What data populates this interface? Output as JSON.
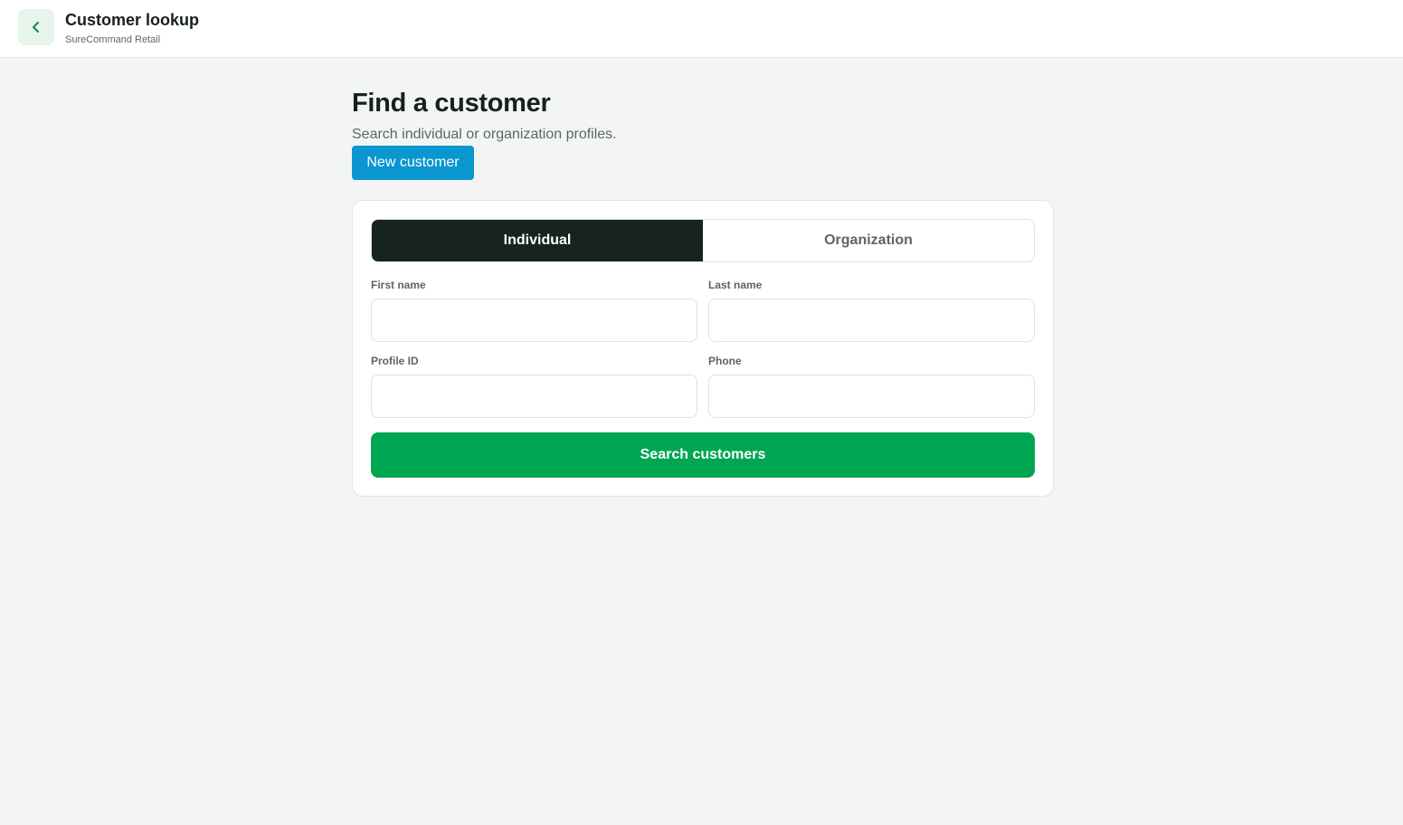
{
  "header": {
    "back_icon": "chevron-left-icon",
    "title": "Customer lookup",
    "subtitle": "SureCommand Retail"
  },
  "main": {
    "title": "Find a customer",
    "description": "Search individual or organization profiles.",
    "new_customer_label": "New customer"
  },
  "search_card": {
    "tabs": [
      {
        "label": "Individual",
        "active": true
      },
      {
        "label": "Organization",
        "active": false
      }
    ],
    "fields": {
      "first_name": {
        "label": "First name",
        "value": ""
      },
      "last_name": {
        "label": "Last name",
        "value": ""
      },
      "profile_id": {
        "label": "Profile ID",
        "value": ""
      },
      "phone": {
        "label": "Phone",
        "value": ""
      }
    },
    "search_label": "Search customers"
  },
  "colors": {
    "primary_action": "#00a651",
    "secondary_action": "#0a96cf",
    "active_tab": "#172320",
    "back_button_bg": "#e6f4ec"
  }
}
